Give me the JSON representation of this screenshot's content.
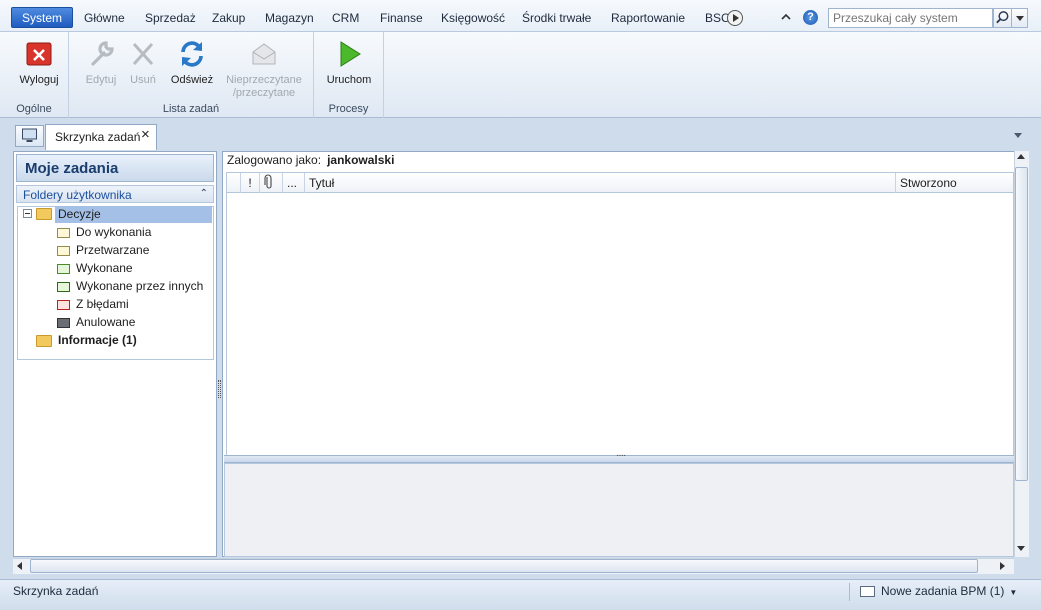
{
  "menu": {
    "items": [
      "System",
      "Główne",
      "Sprzedaż",
      "Zakup",
      "Magazyn",
      "CRM",
      "Finanse",
      "Księgowość",
      "Środki trwałe",
      "Raportowanie",
      "BSC"
    ],
    "search_placeholder": "Przeszukaj cały system",
    "help": "?"
  },
  "ribbon": {
    "groups": [
      {
        "label": "Ogólne",
        "buttons": [
          {
            "label": "Wyloguj",
            "enabled": true
          }
        ]
      },
      {
        "label": "Lista zadań",
        "buttons": [
          {
            "label": "Edytuj",
            "enabled": false
          },
          {
            "label": "Usuń",
            "enabled": false
          },
          {
            "label": "Odśwież",
            "enabled": true
          },
          {
            "label": "Nieprzeczytane",
            "label2": "/przeczytane",
            "enabled": false
          }
        ]
      },
      {
        "label": "Procesy",
        "buttons": [
          {
            "label": "Uruchom",
            "enabled": true
          }
        ]
      }
    ]
  },
  "tabs": {
    "active": "Skrzynka zadań",
    "close": "×"
  },
  "left_panel": {
    "title": "Moje zadania",
    "subtitle": "Foldery użytkownika",
    "collapse": "⌃",
    "tree": [
      {
        "label": "Decyzje",
        "selected": true
      },
      {
        "label": "Do wykonania"
      },
      {
        "label": "Przetwarzane"
      },
      {
        "label": "Wykonane"
      },
      {
        "label": "Wykonane przez innych"
      },
      {
        "label": "Z błędami"
      },
      {
        "label": "Anulowane"
      },
      {
        "label": "Informacje (1)",
        "bold": true
      }
    ]
  },
  "content": {
    "logged_label": "Zalogowano jako:",
    "logged_user": "jankowalski",
    "columns": [
      "!",
      "",
      "...",
      "Tytuł",
      "Stworzono"
    ]
  },
  "status": {
    "left": "Skrzynka zadań",
    "notification": "Nowe zadania BPM (1)"
  },
  "colors": {
    "accent": "#1f5cbf",
    "selection": "#a5c0e6",
    "ribbon_bg": "#dfe8f3"
  }
}
